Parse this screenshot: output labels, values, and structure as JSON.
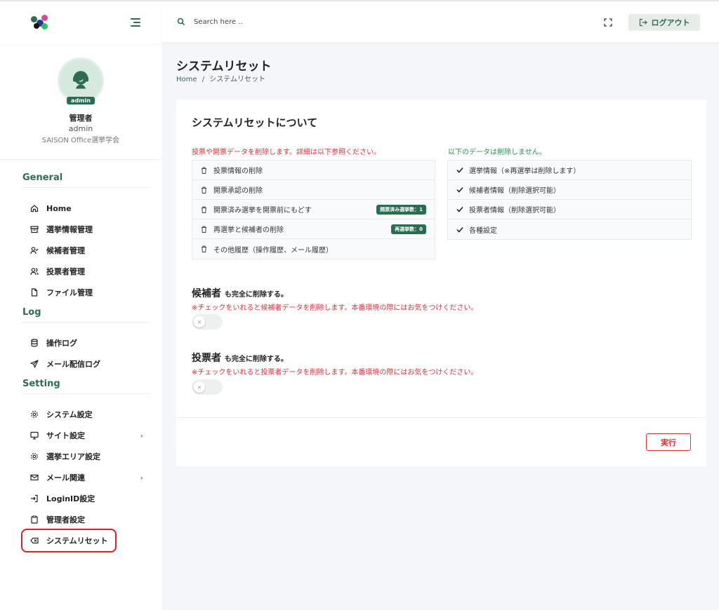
{
  "header": {
    "search_placeholder": "Search here ..",
    "logout_label": "ログアウト"
  },
  "profile": {
    "badge": "admin",
    "name": "管理者",
    "username": "admin",
    "org": "SAISON Office選挙学会"
  },
  "sidebar": {
    "sections": [
      {
        "title": "General",
        "items": [
          "Home",
          "選挙情報管理",
          "候補者管理",
          "投票者管理",
          "ファイル管理"
        ]
      },
      {
        "title": "Log",
        "items": [
          "操作ログ",
          "メール配信ログ"
        ]
      },
      {
        "title": "Setting",
        "items": [
          "システム設定",
          "サイト設定",
          "選挙エリア設定",
          "メール関連",
          "LoginID設定",
          "管理者設定",
          "システムリセット"
        ]
      }
    ],
    "chevron": "›"
  },
  "page": {
    "title": "システムリセット",
    "breadcrumb_home": "Home",
    "breadcrumb_sep": "/",
    "breadcrumb_current": "システムリセット"
  },
  "card": {
    "title": "システムリセットについて",
    "delete_note": "投票や開票データを削除します。詳細は以下参照ください。",
    "keep_note": "以下のデータは削除しません。",
    "delete_items": [
      {
        "label": "投票情報の削除",
        "badge": ""
      },
      {
        "label": "開票承認の削除",
        "badge": ""
      },
      {
        "label": "開票済み選挙を開票前にもどす",
        "badge": "開票済み選挙数：1"
      },
      {
        "label": "再選挙と候補者の削除",
        "badge": "再選挙数：0"
      },
      {
        "label": "その他履歴（操作履歴、メール履歴）",
        "badge": ""
      }
    ],
    "keep_items": [
      "選挙情報（※再選挙は削除します）",
      "候補者情報（削除選択可能）",
      "投票者情報（削除選択可能）",
      "各種設定"
    ],
    "option1": {
      "title": "候補者",
      "suffix": "も完全に削除する。",
      "warning": "※チェックをいれると候補者データを削除します。本番環境の際にはお気をつけください。"
    },
    "option2": {
      "title": "投票者",
      "suffix": "も完全に削除する。",
      "warning": "※チェックをいれると投票者データを削除します。本番環境の際にはお気をつけください。"
    },
    "toggle_off_glyph": "×",
    "execute_label": "実行"
  },
  "colors": {
    "brand": "#2e6b55",
    "danger": "#e0313b",
    "ok": "#2e8a5a"
  }
}
